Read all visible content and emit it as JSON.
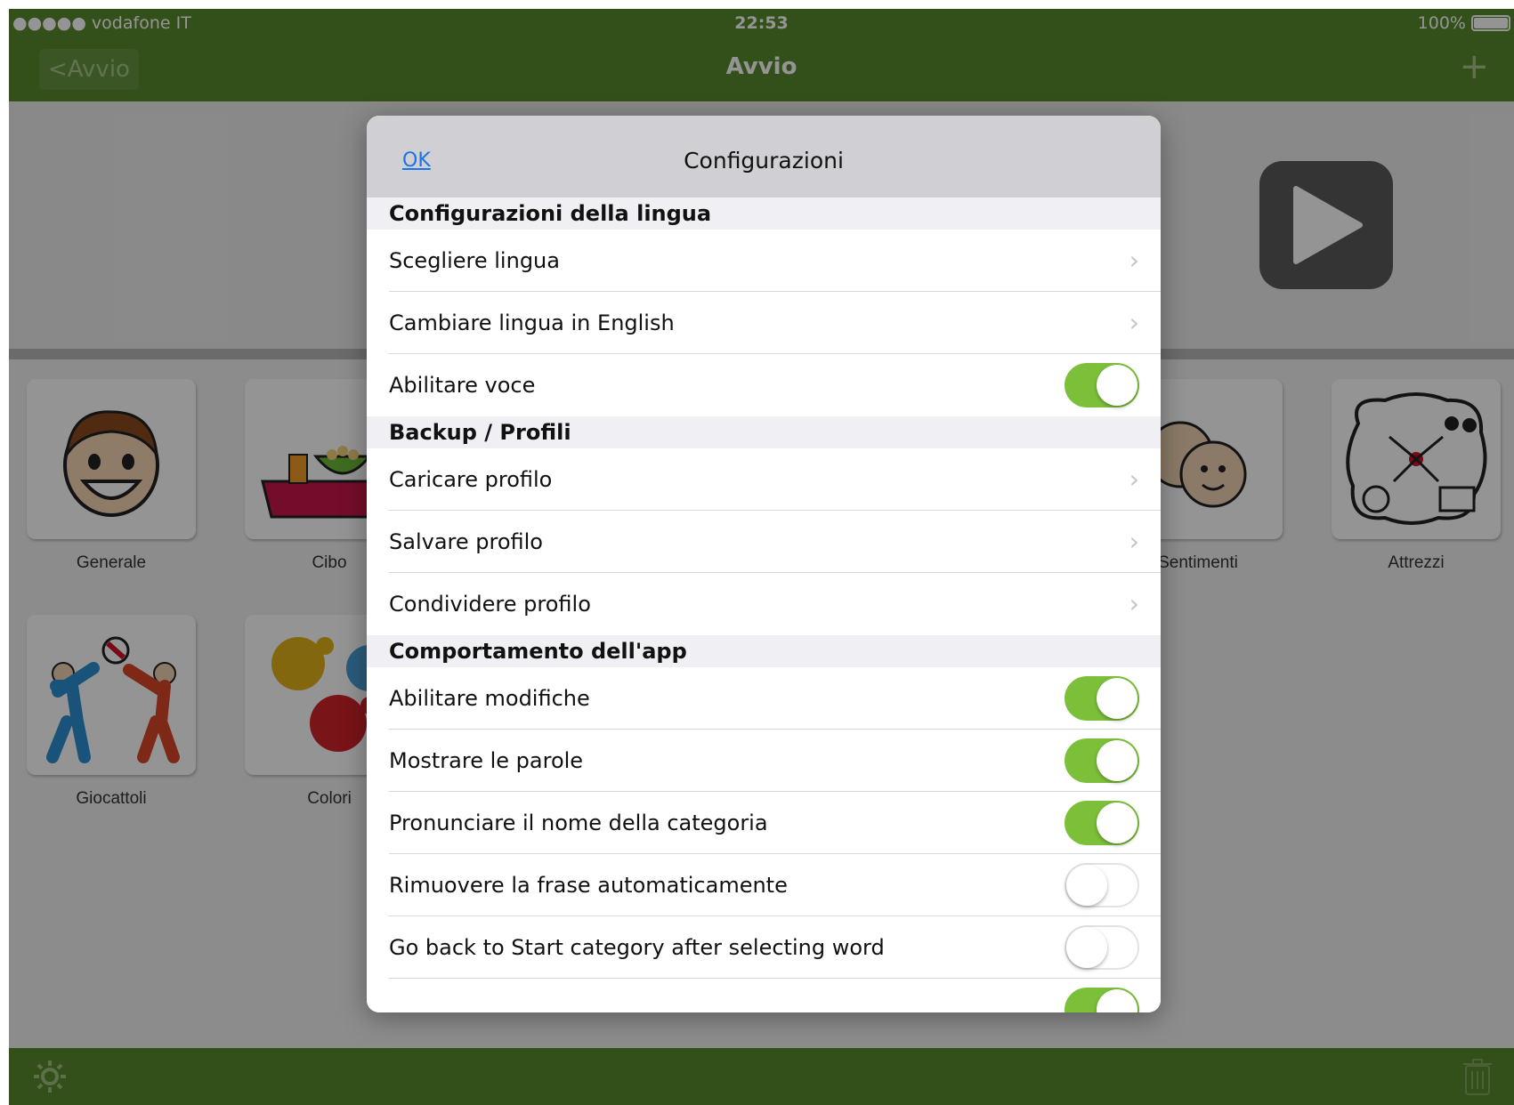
{
  "status_bar": {
    "carrier": "●●●●● vodafone IT",
    "time": "22:53",
    "battery": "100%"
  },
  "nav": {
    "back_label": "<Avvio",
    "title": "Avvio",
    "add_label": "+"
  },
  "categories": [
    {
      "label": "Generale",
      "icon": "smiling-boy-icon"
    },
    {
      "label": "Cibo",
      "icon": "food-table-icon"
    },
    {
      "label": "Sentimenti",
      "icon": "feelings-faces-icon"
    },
    {
      "label": "Attrezzi",
      "icon": "assistive-devices-icon"
    },
    {
      "label": "Giocattoli",
      "icon": "children-playing-ball-icon"
    },
    {
      "label": "Colori",
      "icon": "paint-splashes-icon"
    }
  ],
  "settings": {
    "ok_label": "OK",
    "title": "Configurazioni",
    "sections": [
      {
        "title": "Configurazioni della lingua",
        "rows": [
          {
            "label": "Scegliere lingua",
            "control": "chevron"
          },
          {
            "label": "Cambiare lingua in English",
            "control": "chevron"
          },
          {
            "label": "Abilitare voce",
            "control": "switch",
            "on": true
          }
        ]
      },
      {
        "title": "Backup / Profili",
        "rows": [
          {
            "label": "Caricare profilo",
            "control": "chevron"
          },
          {
            "label": "Salvare profilo",
            "control": "chevron"
          },
          {
            "label": "Condividere profilo",
            "control": "chevron"
          }
        ]
      },
      {
        "title": "Comportamento dell'app",
        "rows": [
          {
            "label": "Abilitare modifiche",
            "control": "switch",
            "on": true
          },
          {
            "label": "Mostrare le parole",
            "control": "switch",
            "on": true
          },
          {
            "label": "Pronunciare il nome della categoria",
            "control": "switch",
            "on": true
          },
          {
            "label": "Rimuovere la frase automaticamente",
            "control": "switch",
            "on": false
          },
          {
            "label": "Go back to Start category after selecting word",
            "control": "switch",
            "on": false
          },
          {
            "label": "",
            "control": "switch",
            "on": true
          }
        ]
      }
    ]
  },
  "colors": {
    "brand_green": "#5b8a2e",
    "switch_on": "#7cc039",
    "link_blue": "#1a73e8"
  }
}
